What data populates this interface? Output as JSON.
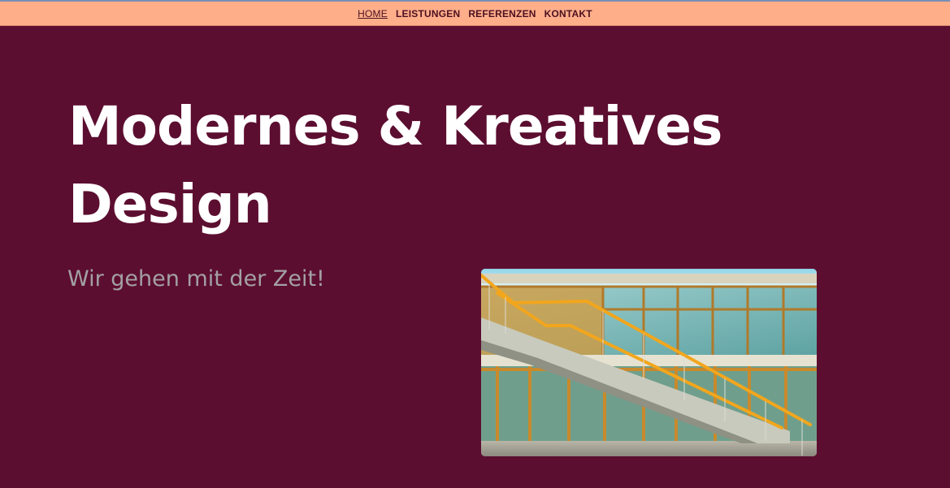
{
  "nav": {
    "items": [
      {
        "label": "HOME",
        "active": true
      },
      {
        "label": "LEISTUNGEN",
        "active": false
      },
      {
        "label": "REFERENZEN",
        "active": false
      },
      {
        "label": "KONTAKT",
        "active": false
      }
    ]
  },
  "hero": {
    "title_line1": "Modernes & Kreatives",
    "title_line2": "Design",
    "subtitle": "Wir gehen mit der Zeit!",
    "image_subject": "modern-building-staircase-photo"
  },
  "colors": {
    "background": "#5c0e30",
    "navbar": "#ffae8a",
    "nav_text": "#4b1020",
    "title": "#ffffff",
    "subtitle": "#a3a0a4"
  }
}
